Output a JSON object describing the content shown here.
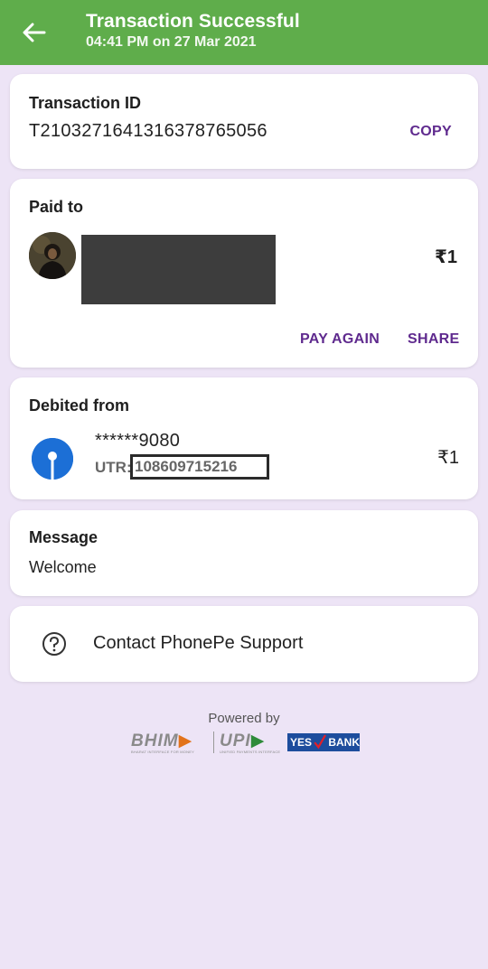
{
  "header": {
    "title": "Transaction Successful",
    "subtitle": "04:41 PM on 27 Mar 2021",
    "bg_color": "#5fad4b"
  },
  "transaction": {
    "title": "Transaction ID",
    "id": "T2103271641316378765056",
    "copy_label": "COPY"
  },
  "paid_to": {
    "title": "Paid to",
    "amount": "₹1",
    "pay_again_label": "PAY AGAIN",
    "share_label": "SHARE"
  },
  "debited_from": {
    "title": "Debited from",
    "account": "******9080",
    "utr_label": "UTR:",
    "utr_value": "108609715216",
    "amount": "₹1"
  },
  "message": {
    "title": "Message",
    "text": "Welcome"
  },
  "support": {
    "label": "Contact PhonePe Support"
  },
  "footer": {
    "powered_by": "Powered by",
    "bhim": "BHIM",
    "bhim_tagline": "BHARAT INTERFACE FOR MONEY",
    "upi": "UPI",
    "upi_tagline": "UNIFIED PAYMENTS INTERFACE",
    "yes": "YES",
    "bank": "BANK"
  },
  "colors": {
    "accent": "#5f2a8e",
    "background": "#ede4f6",
    "bank_logo": "#1c6fd6"
  }
}
